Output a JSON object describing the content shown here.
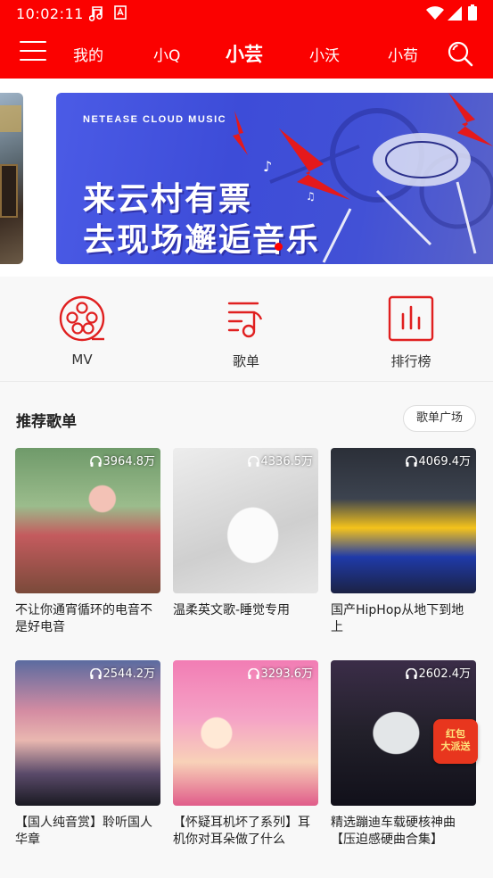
{
  "status_bar": {
    "time": "10:02:11"
  },
  "nav": {
    "tabs": [
      {
        "label": "我的"
      },
      {
        "label": "小Q"
      },
      {
        "label": "小芸"
      },
      {
        "label": "小沃"
      },
      {
        "label": "小苟"
      }
    ],
    "active_tab": "小芸"
  },
  "banner": {
    "brand": "NETEASE CLOUD MUSIC",
    "line1": "来云村有票",
    "line2": "去现场邂逅音乐"
  },
  "quick_entries": [
    {
      "label": "MV",
      "icon": "film-reel-icon"
    },
    {
      "label": "歌单",
      "icon": "playlist-icon"
    },
    {
      "label": "排行榜",
      "icon": "chart-icon"
    }
  ],
  "recommend": {
    "title": "推荐歌单",
    "more_label": "歌单广场",
    "playlists": [
      {
        "plays": "3964.8万",
        "title": "不让你通宵循环的电音不是好电音"
      },
      {
        "plays": "4336.5万",
        "title": "温柔英文歌-睡觉专用"
      },
      {
        "plays": "4069.4万",
        "title": "国产HipHop从地下到地上"
      },
      {
        "plays": "2544.2万",
        "title": "【国人纯音赏】聆听国人华章"
      },
      {
        "plays": "3293.6万",
        "title": "【怀疑耳机坏了系列】耳机你对耳朵做了什么"
      },
      {
        "plays": "2602.4万",
        "title": "精选蹦迪车载硬核神曲【压迫感硬曲合集】"
      }
    ]
  },
  "floating_promo": {
    "line1": "红包",
    "line2": "大派送"
  },
  "colors": {
    "brand_red": "#fb0100",
    "accent_red": "#e02020"
  }
}
